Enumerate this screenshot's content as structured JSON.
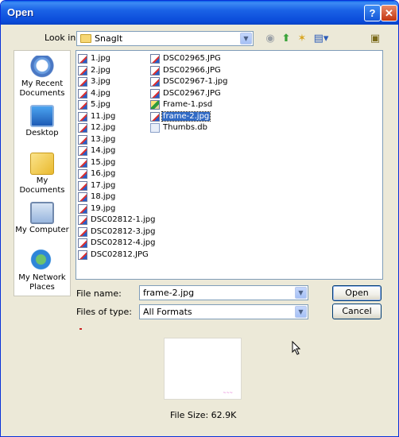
{
  "window": {
    "title": "Open",
    "help_glyph": "?",
    "close_glyph": "✕"
  },
  "toolbar": {
    "look_in_label": "Look in:",
    "look_in_value": "SnagIt",
    "back_icon": "◉",
    "up_icon": "⬆",
    "new_folder_icon": "✶",
    "views_icon": "▤▾",
    "tools_icon": "▣"
  },
  "places": [
    {
      "label": "My Recent Documents",
      "icon": "recent-documents-icon"
    },
    {
      "label": "Desktop",
      "icon": "desktop-icon"
    },
    {
      "label": "My Documents",
      "icon": "my-documents-icon"
    },
    {
      "label": "My Computer",
      "icon": "my-computer-icon"
    },
    {
      "label": "My Network Places",
      "icon": "network-places-icon"
    }
  ],
  "files": {
    "column1": [
      "1.jpg",
      "2.jpg",
      "3.jpg",
      "4.jpg",
      "5.jpg",
      "11.jpg",
      "12.jpg",
      "13.jpg",
      "14.jpg",
      "15.jpg",
      "16.jpg",
      "17.jpg",
      "18.jpg",
      "19.jpg",
      "DSC02812-1.jpg",
      "DSC02812-3.jpg",
      "DSC02812-4.jpg",
      "DSC02812.JPG"
    ],
    "column2": [
      "DSC02965.JPG",
      "DSC02966.JPG",
      "DSC02967-1.jpg",
      "DSC02967.JPG",
      "Frame-1.psd",
      "frame-2.jpg",
      "Thumbs.db"
    ],
    "selected": "frame-2.jpg"
  },
  "form": {
    "file_name_label": "File name:",
    "file_name_value": "frame-2.jpg",
    "file_type_label": "Files of type:",
    "file_type_value": "All Formats",
    "open_label": "Open",
    "cancel_label": "Cancel",
    "dropdown_glyph": "▼"
  },
  "preview": {
    "file_size": "File Size: 62.9K"
  }
}
